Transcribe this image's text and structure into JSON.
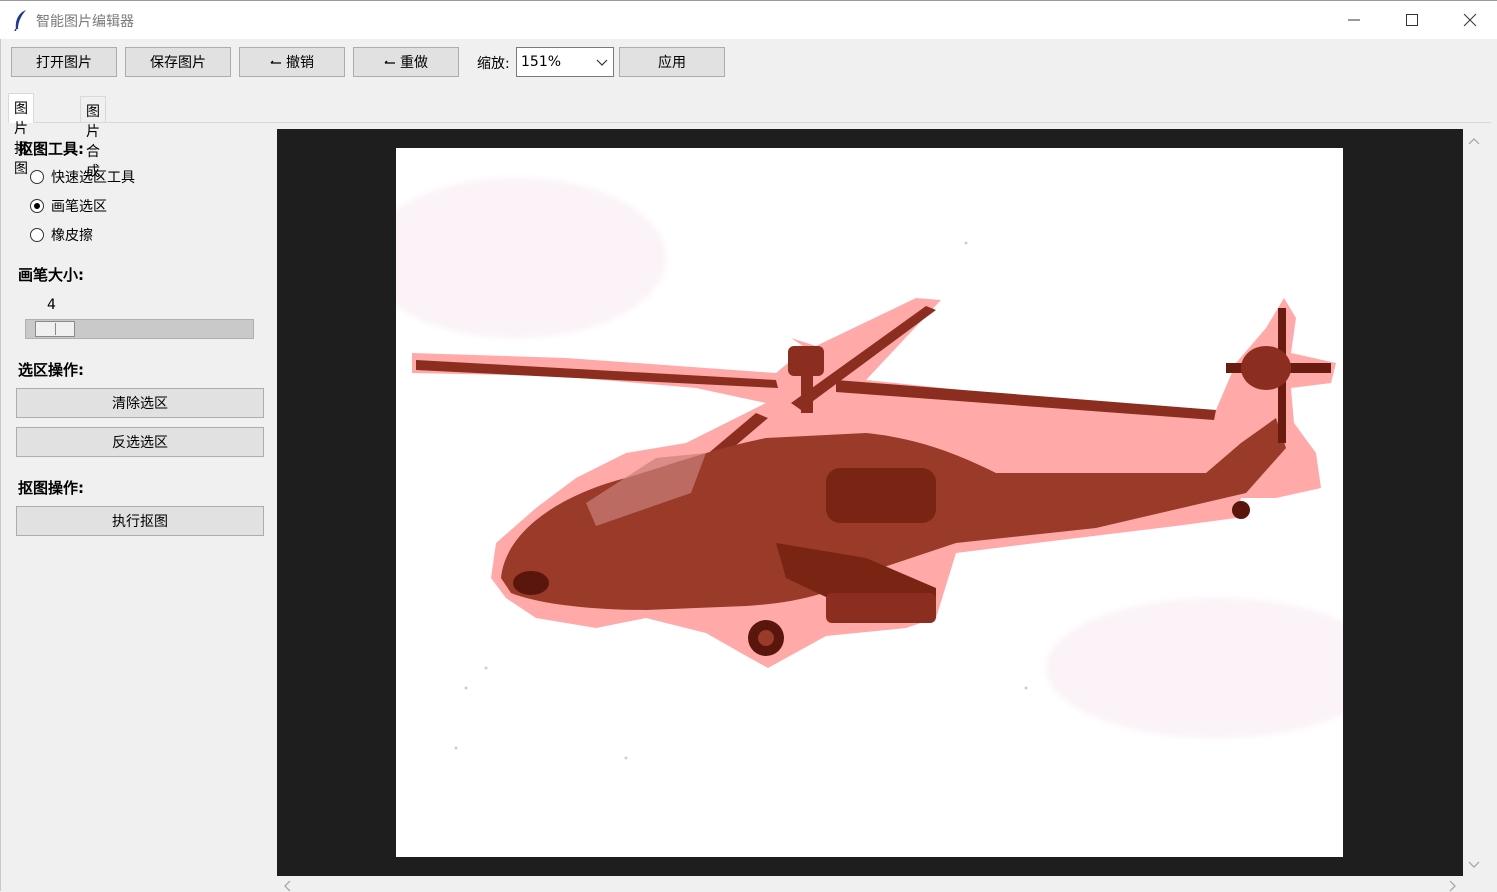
{
  "window": {
    "title": "智能图片编辑器"
  },
  "toolbar": {
    "open_label": "打开图片",
    "save_label": "保存图片",
    "undo_label": "撤销",
    "redo_label": "重做",
    "zoom_label": "缩放:",
    "zoom_value": "151%",
    "apply_label": "应用"
  },
  "tabs": [
    {
      "label": "图片抠图",
      "active": true
    },
    {
      "label": "图片合成",
      "active": false
    }
  ],
  "cutout_panel": {
    "tool_label": "抠图工具:",
    "tools": [
      {
        "label": "快速选区工具",
        "checked": false
      },
      {
        "label": "画笔选区",
        "checked": true
      },
      {
        "label": "橡皮擦",
        "checked": false
      }
    ],
    "brush_size_label": "画笔大小:",
    "brush_size_value": "4",
    "brush_size_fraction": 0.04,
    "selection_ops_label": "选区操作:",
    "clear_selection_label": "清除选区",
    "invert_selection_label": "反选选区",
    "cutout_ops_label": "抠图操作:",
    "execute_cutout_label": "执行抠图"
  },
  "colors": {
    "canvas_background": "#1e1e1e",
    "selection_overlay": "#ff8a8a",
    "helicopter_body": "#9a3a28"
  },
  "icons": [
    "feather-icon",
    "minimize-icon",
    "maximize-icon",
    "close-icon",
    "chevron-down-icon",
    "undo-arrow-icon",
    "redo-arrow-icon",
    "scroll-up-icon",
    "scroll-down-icon",
    "scroll-left-icon",
    "scroll-right-icon"
  ]
}
